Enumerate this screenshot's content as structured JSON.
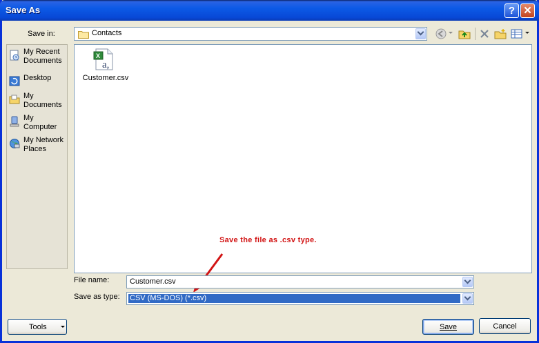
{
  "window": {
    "title": "Save As"
  },
  "titlebar": {
    "help_label": "?",
    "close_label": "✕"
  },
  "save_in": {
    "label": "Save in:",
    "value": "Contacts"
  },
  "places": [
    {
      "label": "My Recent Documents",
      "icon": "recent-documents-icon"
    },
    {
      "label": "Desktop",
      "icon": "desktop-icon"
    },
    {
      "label": "My Documents",
      "icon": "my-documents-icon"
    },
    {
      "label": "My Computer",
      "icon": "my-computer-icon"
    },
    {
      "label": "My Network Places",
      "icon": "network-places-icon"
    }
  ],
  "files": [
    {
      "name": "Customer.csv",
      "icon": "excel-csv-file-icon"
    }
  ],
  "annotation": {
    "text": "Save the file as .csv type."
  },
  "filename": {
    "label": "File name:",
    "value": "Customer.csv"
  },
  "filetype": {
    "label": "Save as type:",
    "value": "CSV (MS-DOS) (*.csv)"
  },
  "buttons": {
    "tools": "Tools",
    "save": "Save",
    "cancel": "Cancel"
  },
  "colors": {
    "titlebar": "#0c5ae6",
    "annotation": "#d21414",
    "selection": "#316ac5",
    "dialog_bg": "#ece9d8"
  }
}
